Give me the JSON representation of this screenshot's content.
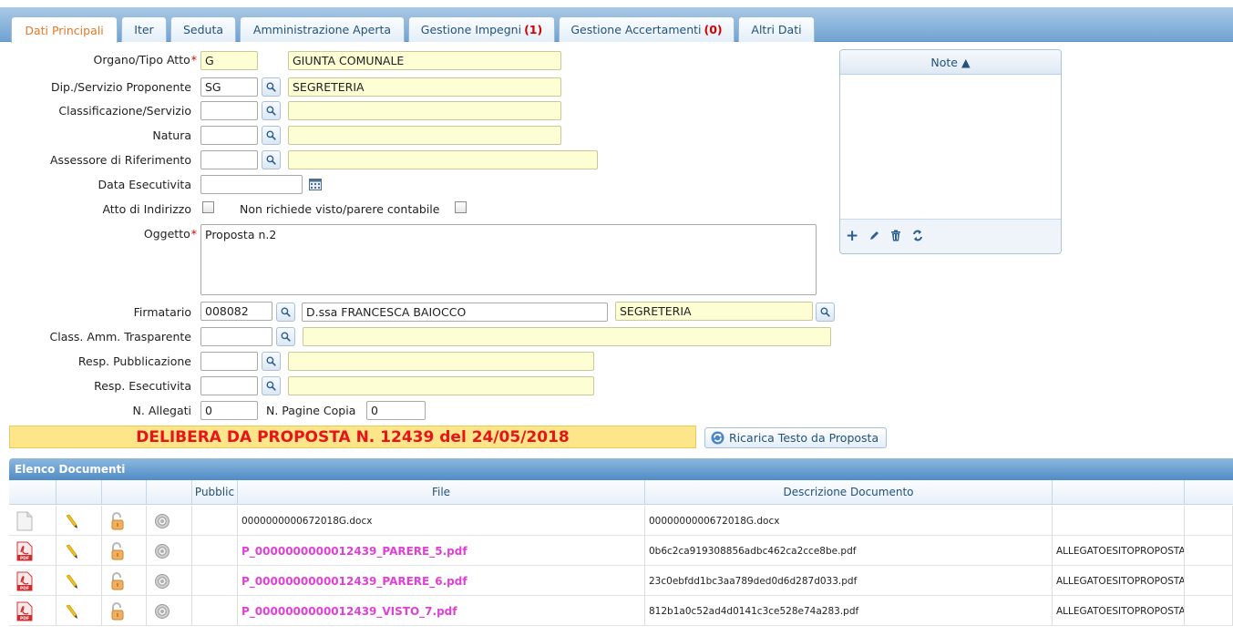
{
  "tabs": [
    {
      "label": "Dati Principali",
      "count": ""
    },
    {
      "label": "Iter",
      "count": ""
    },
    {
      "label": "Seduta",
      "count": ""
    },
    {
      "label": "Amministrazione Aperta",
      "count": ""
    },
    {
      "label": "Gestione Impegni",
      "count": "(1)"
    },
    {
      "label": "Gestione Accertamenti",
      "count": "(0)"
    },
    {
      "label": "Altri Dati",
      "count": ""
    }
  ],
  "form": {
    "organo_label": "Organo/Tipo Atto",
    "organo_code": "G",
    "organo_desc": "GIUNTA COMUNALE",
    "dip_label": "Dip./Servizio Proponente",
    "dip_code": "SG",
    "dip_desc": "SEGRETERIA",
    "class_label": "Classificazione/Servizio",
    "class_code": "",
    "class_desc": "",
    "natura_label": "Natura",
    "natura_code": "",
    "natura_desc": "",
    "assessore_label": "Assessore di Riferimento",
    "assessore_code": "",
    "assessore_desc": "",
    "data_esec_label": "Data Esecutivita",
    "data_esec_value": "",
    "atto_indirizzo_label": "Atto di Indirizzo",
    "non_richiede_label": "Non richiede visto/parere contabile",
    "oggetto_label": "Oggetto",
    "oggetto_value": "Proposta n.2",
    "firmatario_label": "Firmatario",
    "firmatario_code": "008082",
    "firmatario_name": "D.ssa FRANCESCA BAIOCCO",
    "firmatario_office": "SEGRETERIA",
    "class_amm_label": "Class. Amm. Trasparente",
    "class_amm_code": "",
    "class_amm_desc": "",
    "resp_pub_label": "Resp. Pubblicazione",
    "resp_pub_code": "",
    "resp_pub_desc": "",
    "resp_esec_label": "Resp. Esecutivita",
    "resp_esec_code": "",
    "resp_esec_desc": "",
    "n_allegati_label": "N. Allegati",
    "n_allegati_value": "0",
    "n_pagine_label": "N. Pagine Copia",
    "n_pagine_value": "0"
  },
  "notes": {
    "header": "Note ▲"
  },
  "delibera_text": "DELIBERA DA PROPOSTA N. 12439 del 24/05/2018",
  "reload_button": "Ricarica Testo da Proposta",
  "documents": {
    "title": "Elenco Documenti",
    "headers": [
      "",
      "",
      "",
      "",
      "Pubblic",
      "File",
      "Descrizione Documento",
      "",
      ""
    ],
    "rows": [
      {
        "type": "doc",
        "file": "0000000000672018G.docx",
        "descr": "0000000000672018G.docx",
        "tag": "",
        "link": false
      },
      {
        "type": "pdf",
        "file": "P_0000000000012439_PARERE_5.pdf",
        "descr": "0b6c2ca919308856adbc462ca2cce8be.pdf",
        "tag": "ALLEGATOESITOPROPOSTA",
        "link": true
      },
      {
        "type": "pdf",
        "file": "P_0000000000012439_PARERE_6.pdf",
        "descr": "23c0ebfdd1bc3aa789ded0d6d287d033.pdf",
        "tag": "ALLEGATOESITOPROPOSTA",
        "link": true
      },
      {
        "type": "pdf",
        "file": "P_0000000000012439_VISTO_7.pdf",
        "descr": "812b1a0c52ad4d0141c3ce528e74a283.pdf",
        "tag": "ALLEGATOESITOPROPOSTA",
        "link": true
      }
    ]
  },
  "colors": {
    "active_tab": "#e87722",
    "required": "#d40000",
    "delibera_text": "#e8141b",
    "delibera_bg": "#fde58a",
    "link": "#e040d8",
    "header_blue": "#4f8cc5"
  }
}
